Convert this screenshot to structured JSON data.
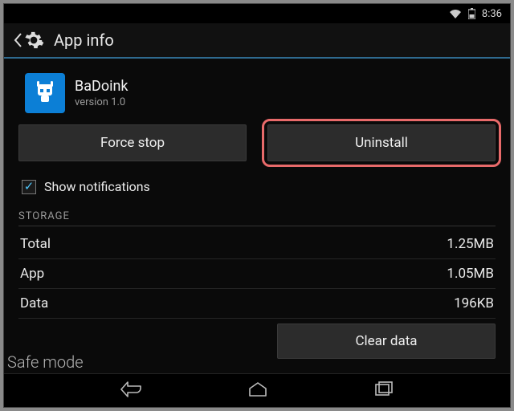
{
  "statusbar": {
    "time": "8:36"
  },
  "header": {
    "title": "App info"
  },
  "app": {
    "name": "BaDoink",
    "version": "version 1.0"
  },
  "buttons": {
    "force_stop": "Force stop",
    "uninstall": "Uninstall",
    "clear_data": "Clear data"
  },
  "notifications": {
    "label": "Show notifications",
    "checked": true
  },
  "storage": {
    "header": "STORAGE",
    "rows": [
      {
        "label": "Total",
        "value": "1.25MB"
      },
      {
        "label": "App",
        "value": "1.05MB"
      },
      {
        "label": "Data",
        "value": "196KB"
      }
    ]
  },
  "overlay": {
    "safe_mode": "Safe mode"
  }
}
